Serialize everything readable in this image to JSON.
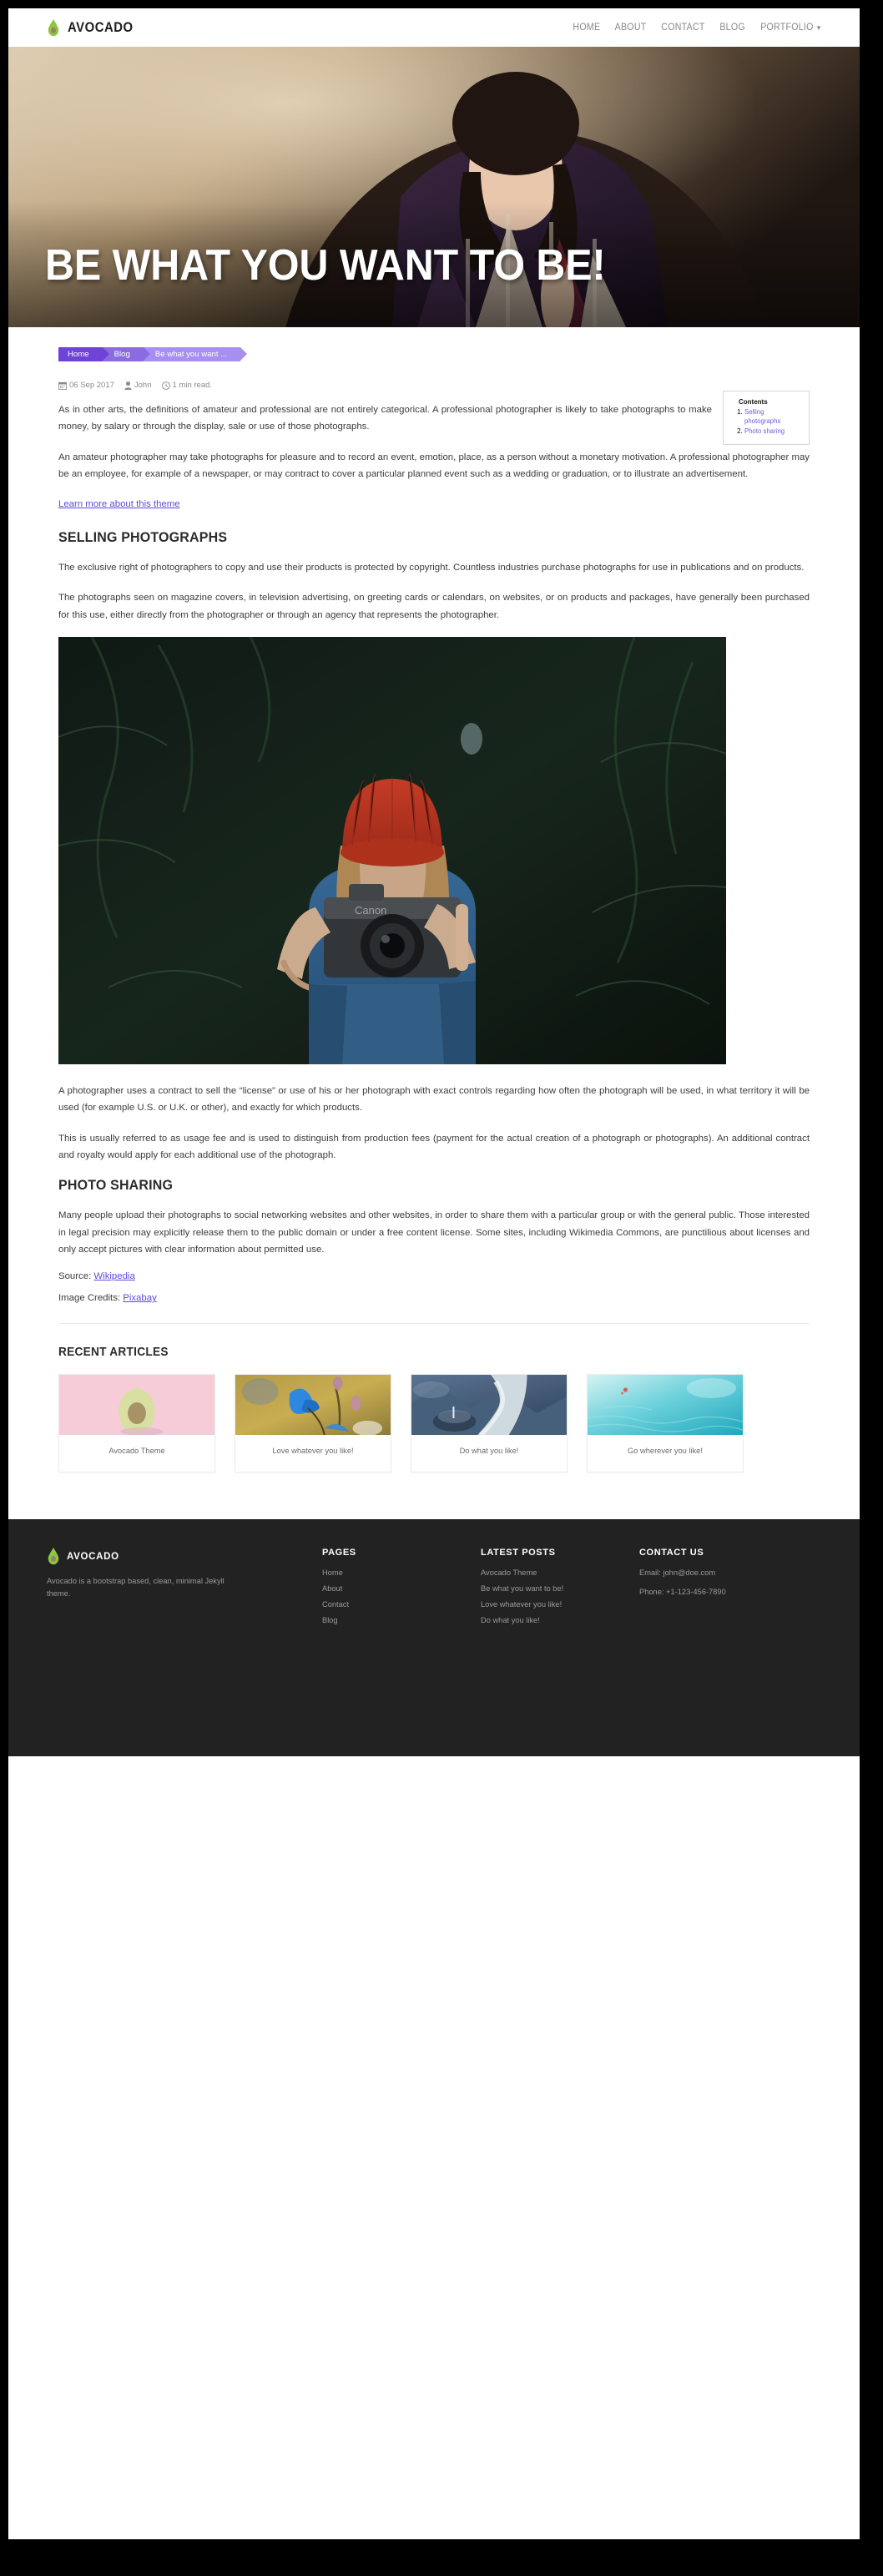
{
  "navbar": {
    "brand": "AVOCADO",
    "links": [
      {
        "label": "HOME"
      },
      {
        "label": "ABOUT"
      },
      {
        "label": "CONTACT"
      },
      {
        "label": "BLOG"
      },
      {
        "label": "PORTFOLIO"
      }
    ]
  },
  "hero": {
    "title": "BE WHAT YOU WANT TO BE!"
  },
  "breadcrumb": [
    {
      "label": "Home"
    },
    {
      "label": "Blog"
    },
    {
      "label": "Be what you want ..."
    }
  ],
  "meta": {
    "date": "06 Sep 2017",
    "author": "John",
    "read_time": "1 min read."
  },
  "contents": {
    "title": "Contents",
    "items": [
      {
        "label": "Selling photographs"
      },
      {
        "label": "Photo sharing"
      }
    ]
  },
  "article": {
    "p1": "As in other arts, the definitions of amateur and professional are not entirely categorical. A professional photographer is likely to take photographs to make money, by salary or through the display, sale or use of those photographs.",
    "p2": "An amateur photographer may take photographs for pleasure and to record an event, emotion, place, as a person without a monetary motivation. A professional photographer may be an employee, for example of a newspaper, or may contract to cover a particular planned event such as a wedding or graduation, or to illustrate an advertisement.",
    "theme_link": "Learn more about this theme",
    "h2_selling": "SELLING PHOTOGRAPHS",
    "p3": "The exclusive right of photographers to copy and use their products is protected by copyright. Countless industries purchase photographs for use in publications and on products.",
    "p4": "The photographs seen on magazine covers, in television advertising, on greeting cards or calendars, on websites, or on products and packages, have generally been purchased for this use, either directly from the photographer or through an agency that represents the photographer.",
    "p5": "A photographer uses a contract to sell the “license” or use of his or her photograph with exact controls regarding how often the photograph will be used, in what territory it will be used (for example U.S. or U.K. or other), and exactly for which products.",
    "p6": "This is usually referred to as usage fee and is used to distinguish from production fees (payment for the actual creation of a photograph or photographs). An additional contract and royalty would apply for each additional use of the photograph.",
    "h2_sharing": "PHOTO SHARING",
    "p7": "Many people upload their photographs to social networking websites and other websites, in order to share them with a particular group or with the general public. Those interested in legal precision may explicitly release them to the public domain or under a free content license. Some sites, including Wikimedia Commons, are punctilious about licenses and only accept pictures with clear information about permitted use.",
    "source_label": "Source: ",
    "source_link": "Wikipedia",
    "credits_label": "Image Credits: ",
    "credits_link": "Pixabay"
  },
  "recent": {
    "title": "RECENT ARTICLES",
    "cards": [
      {
        "label": "Avocado Theme",
        "theme": "avocado"
      },
      {
        "label": "Love whatever you like!",
        "theme": "flower"
      },
      {
        "label": "Do what you like!",
        "theme": "mountain"
      },
      {
        "label": "Go wherever you like!",
        "theme": "ocean"
      }
    ]
  },
  "footer": {
    "brand": "AVOCADO",
    "description": "Avocado is a bootstrap based, clean, minimal Jekyll theme.",
    "pages": {
      "title": "PAGES",
      "items": [
        {
          "label": "Home"
        },
        {
          "label": "About"
        },
        {
          "label": "Contact"
        },
        {
          "label": "Blog"
        }
      ]
    },
    "latest": {
      "title": "LATEST POSTS",
      "items": [
        {
          "label": "Avocado Theme"
        },
        {
          "label": "Be what you want to be!"
        },
        {
          "label": "Love whatever you like!"
        },
        {
          "label": "Do what you like!"
        }
      ]
    },
    "contact": {
      "title": "CONTACT US",
      "email": "Email: john@doe.com",
      "phone": "Phone: +1-123-456-7890"
    }
  },
  "colors": {
    "accent_purple": "#6f42d8",
    "link_purple": "#5c4ae0",
    "footer_bg": "#222222",
    "avocado_green": "#8dc63f"
  }
}
